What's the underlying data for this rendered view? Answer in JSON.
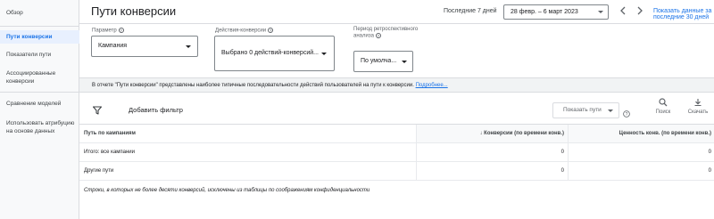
{
  "sidebar": {
    "items": [
      {
        "label": "Обзор"
      },
      {
        "label": "Пути конверсии"
      },
      {
        "label": "Показатели пути"
      },
      {
        "label": "Ассоциированные конверсии"
      },
      {
        "label": "Сравнение моделей"
      },
      {
        "label": "Использовать атрибуцию на основе данных"
      }
    ]
  },
  "header": {
    "title": "Пути конверсии",
    "date_label": "Последние 7 дней",
    "date_range": "28 февр. – 6 март 2023",
    "show_last30": "Показать данные за последние 30 дней"
  },
  "filters": {
    "param_label": "Параметр",
    "param_value": "Кампания",
    "actions_label": "Действия-конверсии",
    "actions_value": "Выбрано 0 действий-конверсий...",
    "period_label": "Период ретроспективного анализа",
    "period_value": "По умолча..."
  },
  "info": {
    "text": "В отчете \"Пути конверсии\" представлены наиболее типичные последовательности действий пользователей на пути к конверсии.",
    "link": "Подробнее..."
  },
  "toolbar": {
    "add_filter": "Добавить фильтр",
    "show_path": "Показать пути",
    "search": "Поиск",
    "download": "Скачать"
  },
  "table": {
    "headers": [
      "Путь по кампаниям",
      "Конверсии (по времени конв.)",
      "Ценность конв. (по времени конв.)"
    ],
    "rows": [
      [
        "Итого: все кампании",
        "0",
        "0"
      ],
      [
        "Другие пути",
        "0",
        "0"
      ]
    ],
    "note": "Строки, в которых не более десяти конверсий, исключены из таблицы по соображениям конфиденциальности"
  },
  "colors": {
    "accent": "#1a73e8",
    "sidebar_active_bg": "#e8f0fe",
    "banner_bg": "#f1f3f4"
  },
  "icons": [
    "filter-icon",
    "help-icon",
    "search-icon",
    "download-icon",
    "chevron-left-icon",
    "chevron-right-icon",
    "arrow-down-icon"
  ]
}
